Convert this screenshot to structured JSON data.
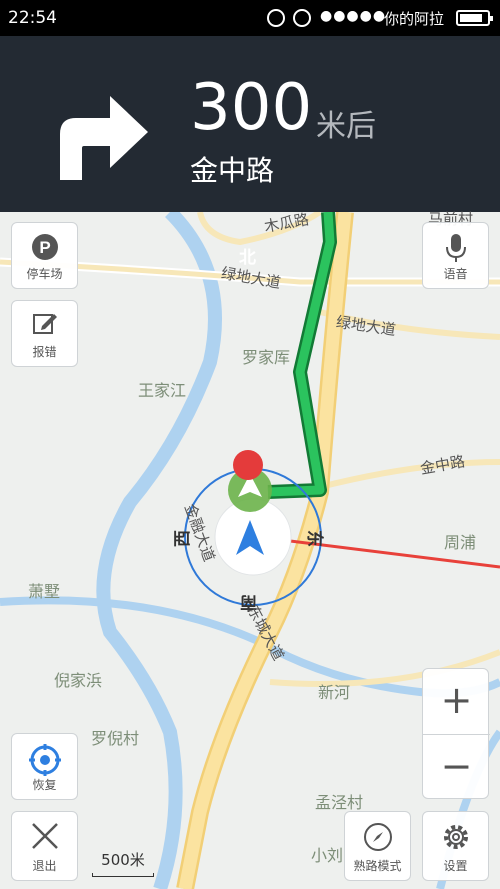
{
  "status_bar": {
    "time": "22:54",
    "carrier": "你的阿拉",
    "signal": "●●●●●",
    "icons": [
      "sync-icon",
      "alarm-icon",
      "signal-icon",
      "battery-icon"
    ]
  },
  "nav_header": {
    "turn_icon": "turn-right-arrow-icon",
    "distance": "300",
    "unit": "米后",
    "next_road": "金中路"
  },
  "map": {
    "compass": {
      "north": "北",
      "south": "南",
      "east": "东",
      "west": "西"
    },
    "place_labels": [
      "王家江",
      "罗家厍",
      "萧墅",
      "倪家浜",
      "罗倪村",
      "新河",
      "周浦",
      "孟泾村",
      "小刘"
    ],
    "road_labels": [
      "绿地大道",
      "绿地大道",
      "金中路",
      "金融大道",
      "东城大道",
      "木瓜路",
      "马前村"
    ]
  },
  "controls": {
    "parking": "停车场",
    "report": "报错",
    "voice": "语音",
    "restore": "恢复",
    "exit": "退出",
    "familiar_mode": "熟路模式",
    "settings": "设置",
    "zoom_in": "+",
    "zoom_out": "−"
  },
  "scale": "500米",
  "colors": {
    "route": "#1aa84a",
    "header_bg": "#232a33",
    "major_road": "#fbe3a0",
    "river": "#aed2f0",
    "direction_line": "#e8413a"
  }
}
